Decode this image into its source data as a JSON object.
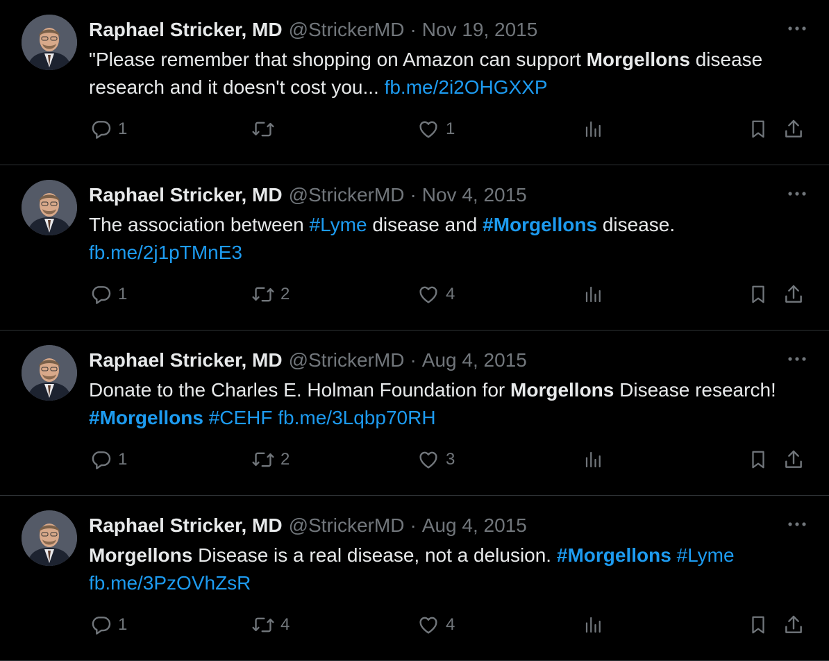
{
  "author": {
    "name": "Raphael Stricker, MD",
    "handle": "@StrickerMD",
    "dot": "·",
    "avatar_icon": "profile-photo-icon"
  },
  "icons": {
    "more": "ellipsis-icon",
    "reply": "reply-bubble-icon",
    "retweet": "retweet-arrows-icon",
    "like": "heart-icon",
    "views": "bar-chart-icon",
    "bookmark": "bookmark-icon",
    "share": "share-upload-icon"
  },
  "colors": {
    "background": "#000000",
    "text": "#e7e9ea",
    "muted": "#71767b",
    "link": "#1d9bf0",
    "divider": "#2f3336"
  },
  "tweets": [
    {
      "date": "Nov 19, 2015",
      "segments": [
        {
          "t": "text",
          "v": "\"Please remember that shopping on Amazon can support "
        },
        {
          "t": "bold",
          "v": "Morgellons"
        },
        {
          "t": "text",
          "v": " disease research and it doesn't cost you... "
        },
        {
          "t": "link",
          "v": "fb.me/2i2OHGXXP"
        }
      ],
      "replies": "1",
      "retweets": "",
      "likes": "1"
    },
    {
      "date": "Nov 4, 2015",
      "segments": [
        {
          "t": "text",
          "v": "The association between "
        },
        {
          "t": "hashtag",
          "v": "#Lyme"
        },
        {
          "t": "text",
          "v": " disease and "
        },
        {
          "t": "hashtag-bold",
          "v": "#Morgellons"
        },
        {
          "t": "text",
          "v": " disease."
        },
        {
          "t": "break",
          "v": ""
        },
        {
          "t": "link",
          "v": "fb.me/2j1pTMnE3"
        }
      ],
      "replies": "1",
      "retweets": "2",
      "likes": "4"
    },
    {
      "date": "Aug 4, 2015",
      "segments": [
        {
          "t": "text",
          "v": "Donate to the Charles E. Holman Foundation for "
        },
        {
          "t": "bold",
          "v": "Morgellons"
        },
        {
          "t": "text",
          "v": " Disease research! "
        },
        {
          "t": "hashtag-bold",
          "v": "#Morgellons"
        },
        {
          "t": "text",
          "v": " "
        },
        {
          "t": "hashtag",
          "v": "#CEHF"
        },
        {
          "t": "text",
          "v": " "
        },
        {
          "t": "link",
          "v": "fb.me/3Lqbp70RH"
        }
      ],
      "replies": "1",
      "retweets": "2",
      "likes": "3"
    },
    {
      "date": "Aug 4, 2015",
      "segments": [
        {
          "t": "bold",
          "v": "Morgellons"
        },
        {
          "t": "text",
          "v": " Disease is a real disease, not a delusion. "
        },
        {
          "t": "hashtag-bold",
          "v": "#Morgellons"
        },
        {
          "t": "text",
          "v": " "
        },
        {
          "t": "hashtag",
          "v": "#Lyme"
        },
        {
          "t": "break",
          "v": ""
        },
        {
          "t": "link",
          "v": "fb.me/3PzOVhZsR"
        }
      ],
      "replies": "1",
      "retweets": "4",
      "likes": "4"
    }
  ]
}
